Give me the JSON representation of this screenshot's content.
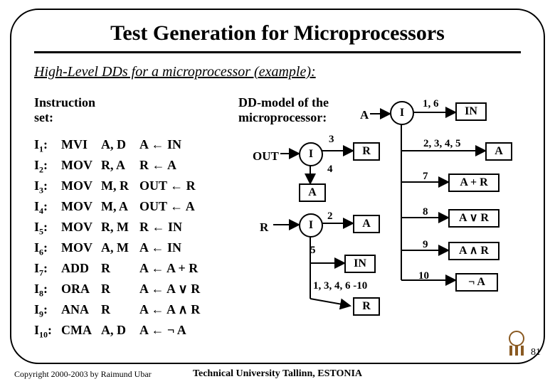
{
  "title": "Test Generation for Microprocessors",
  "subtitle": "High-Level DDs for a microprocessor (example):",
  "instr_label": "Instruction\nset:",
  "dd_label": "DD-model of the\nmicroprocessor:",
  "instructions": [
    {
      "idx": "1",
      "mnem": "MVI",
      "ops": "A, D",
      "sem": "A ← IN"
    },
    {
      "idx": "2",
      "mnem": "MOV",
      "ops": "R, A",
      "sem": "R ← A"
    },
    {
      "idx": "3",
      "mnem": "MOV",
      "ops": "M, R",
      "sem": "OUT ← R"
    },
    {
      "idx": "4",
      "mnem": "MOV",
      "ops": "M, A",
      "sem": "OUT ← A"
    },
    {
      "idx": "5",
      "mnem": "MOV",
      "ops": "R, M",
      "sem": "R ← IN"
    },
    {
      "idx": "6",
      "mnem": "MOV",
      "ops": "A, M",
      "sem": "A ← IN"
    },
    {
      "idx": "7",
      "mnem": "ADD",
      "ops": "R",
      "sem": "A ← A + R"
    },
    {
      "idx": "8",
      "mnem": "ORA",
      "ops": "R",
      "sem": "A ← A ∨ R"
    },
    {
      "idx": "9",
      "mnem": "ANA",
      "ops": "R",
      "sem": "A ← A ∧ R"
    },
    {
      "idx": "10",
      "mnem": "CMA",
      "ops": "A, D",
      "sem": "A ← ¬ A"
    }
  ],
  "dd_labels": {
    "A": "A",
    "OUT": "OUT",
    "R_root": "R",
    "I": "I",
    "edge_top": "1, 6",
    "edge_3": "3",
    "edge_4": "4",
    "edge_2": "2",
    "edge_5": "5",
    "edge_frac": "2, 3, 4, 5",
    "edge_7": "7",
    "edge_8": "8",
    "edge_9": "9",
    "edge_10": "10",
    "list_long": "1, 3, 4, 6 -10"
  },
  "terminals": {
    "IN_top": "IN",
    "R_out": "R",
    "A_out": "A",
    "A_r": "A",
    "IN_r": "IN",
    "R_long": "R",
    "A_right": "A",
    "ApR": "A + R",
    "AvR": "A ∨ R",
    "AaR": "A ∧ R",
    "negA": "¬ A"
  },
  "pagenum": "81",
  "copyright": "Copyright 2000-2003 by Raimund Ubar",
  "footer": "Technical University Tallinn, ESTONIA"
}
